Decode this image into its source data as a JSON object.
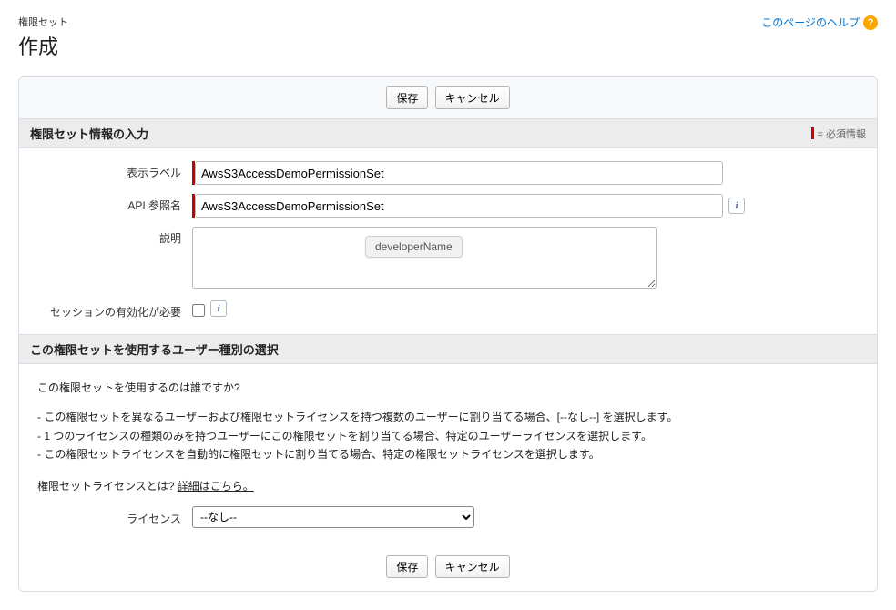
{
  "header": {
    "subtitle": "権限セット",
    "title": "作成",
    "helpLink": "このページのヘルプ"
  },
  "buttons": {
    "save": "保存",
    "cancel": "キャンセル"
  },
  "section1": {
    "title": "権限セット情報の入力",
    "requiredNote": "= 必須情報"
  },
  "form": {
    "displayLabel": {
      "label": "表示ラベル",
      "value": "AwsS3AccessDemoPermissionSet"
    },
    "apiName": {
      "label": "API 参照名",
      "value": "AwsS3AccessDemoPermissionSet",
      "tooltip": "developerName"
    },
    "description": {
      "label": "説明",
      "value": ""
    },
    "sessionActivation": {
      "label": "セッションの有効化が必要"
    }
  },
  "section2": {
    "title": "この権限セットを使用するユーザー種別の選択"
  },
  "info": {
    "question": "この権限セットを使用するのは誰ですか?",
    "bullet1": "- この権限セットを異なるユーザーおよび権限セットライセンスを持つ複数のユーザーに割り当てる場合、[--なし--] を選択します。",
    "bullet2": "- 1 つのライセンスの種類のみを持つユーザーにこの権限セットを割り当てる場合、特定のユーザーライセンスを選択します。",
    "bullet3": "- この権限セットライセンスを自動的に権限セットに割り当てる場合、特定の権限セットライセンスを選択します。",
    "licenseQ": "権限セットライセンスとは? ",
    "detailLink": "詳細はこちら。"
  },
  "license": {
    "label": "ライセンス",
    "selected": "--なし--",
    "options": [
      "--なし--"
    ]
  }
}
